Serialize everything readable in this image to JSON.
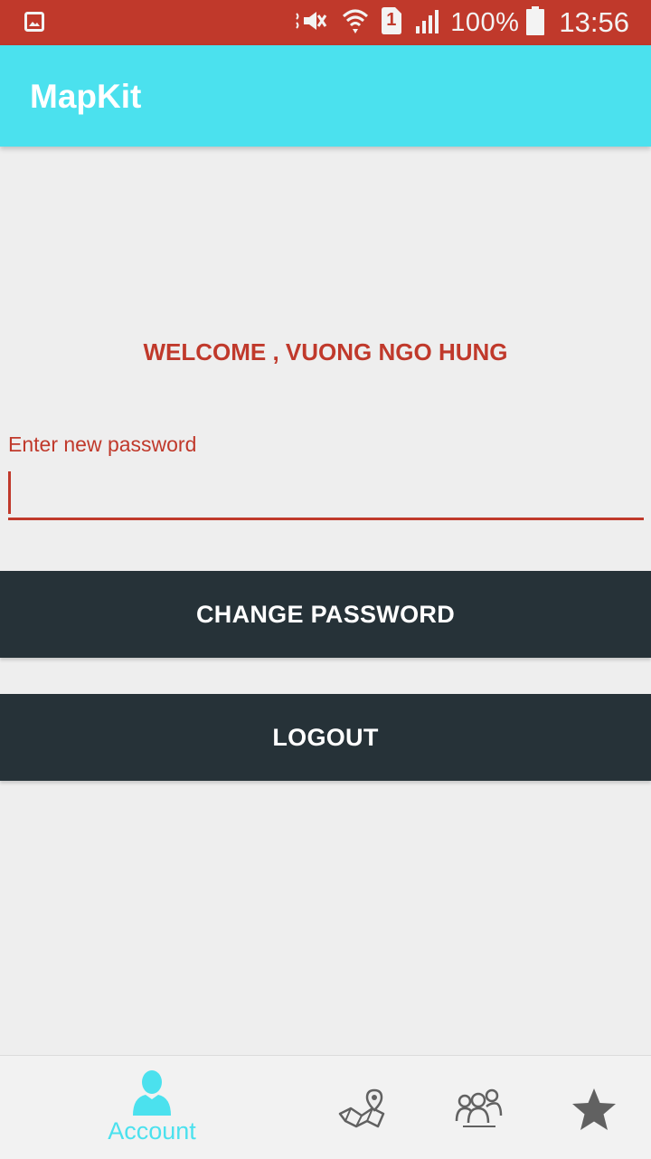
{
  "status_bar": {
    "battery_percent": "100%",
    "time": "13:56",
    "sim_slot": "1"
  },
  "app_bar": {
    "title": "MapKit"
  },
  "main": {
    "welcome": "WELCOME , VUONG NGO HUNG",
    "password_label": "Enter new password",
    "password_value": "",
    "change_password_label": "CHANGE PASSWORD",
    "logout_label": "LOGOUT"
  },
  "bottom_nav": {
    "items": [
      {
        "label": "Account",
        "icon": "person-icon",
        "active": true
      },
      {
        "label": "",
        "icon": "map-pin-icon",
        "active": false
      },
      {
        "label": "",
        "icon": "people-icon",
        "active": false
      },
      {
        "label": "",
        "icon": "star-icon",
        "active": false
      }
    ],
    "active_color": "#4be1ee"
  },
  "colors": {
    "status_bar": "#c0392b",
    "app_bar": "#4be1ee",
    "accent": "#c0392b",
    "button": "#263238",
    "background": "#eeeeee"
  }
}
